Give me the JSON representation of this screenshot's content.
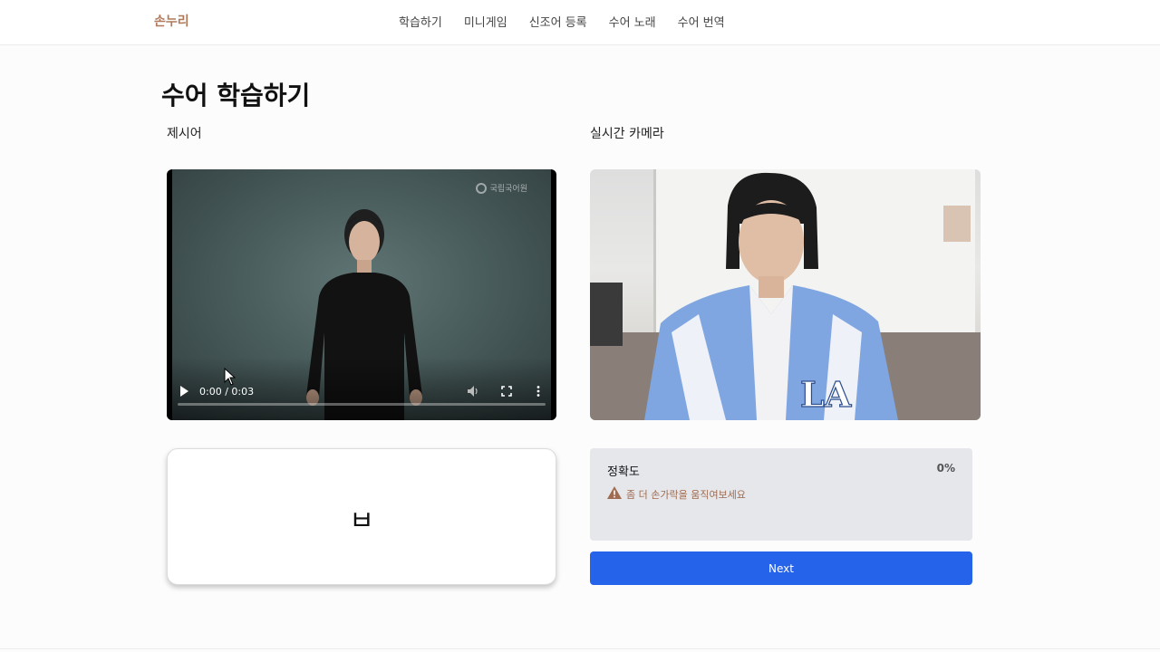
{
  "nav": {
    "brand": "손누리",
    "links": [
      "학습하기",
      "미니게임",
      "신조어 등록",
      "수어 노래",
      "수어 번역"
    ]
  },
  "page": {
    "title": "수어 학습하기",
    "prompt_label": "제시어",
    "camera_label": "실시간 카메라"
  },
  "video": {
    "time": "0:00 / 0:03",
    "watermark": "국립국어원",
    "progress": 0
  },
  "sign": {
    "character": "ㅂ"
  },
  "accuracy": {
    "label": "정확도",
    "value": "0%",
    "warning": "좀 더 손가락을 움직여보세요"
  },
  "actions": {
    "next_label": "Next"
  },
  "colors": {
    "brand": "#b07a5a",
    "primary": "#2563eb",
    "warning": "#a06b50",
    "panel": "#e5e7eb"
  },
  "icons": [
    "play-icon",
    "volume-icon",
    "fullscreen-icon",
    "more-vertical-icon",
    "warning-icon",
    "cursor-icon"
  ]
}
